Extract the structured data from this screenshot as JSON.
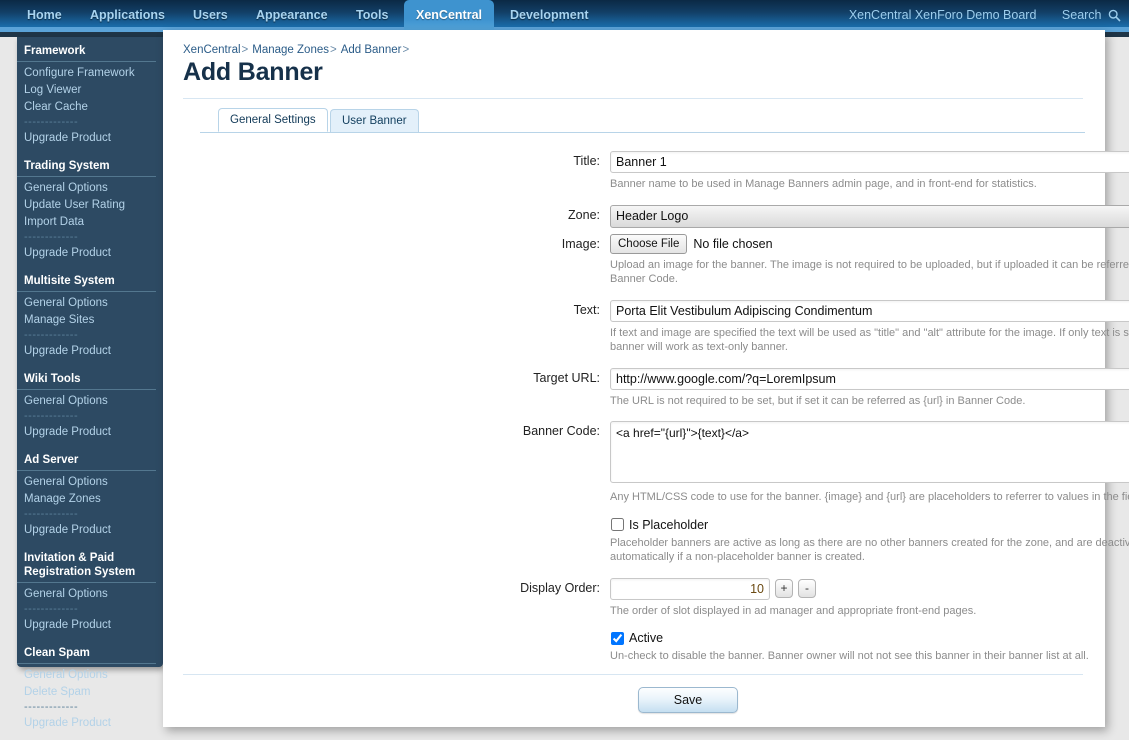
{
  "topnav": {
    "tabs": [
      {
        "label": "Home",
        "active": false
      },
      {
        "label": "Applications",
        "active": false
      },
      {
        "label": "Users",
        "active": false
      },
      {
        "label": "Appearance",
        "active": false
      },
      {
        "label": "Tools",
        "active": false
      },
      {
        "label": "XenCentral",
        "active": true
      },
      {
        "label": "Development",
        "active": false
      }
    ],
    "board_name": "XenCentral XenForo Demo Board",
    "search_label": "Search",
    "accent_active": "#3e93cf",
    "accent_strip": "#5ba3d8"
  },
  "sidebar": {
    "groups": [
      {
        "title": "Framework",
        "items": [
          "Configure Framework",
          "Log Viewer",
          "Clear Cache",
          "-------------",
          "Upgrade Product"
        ]
      },
      {
        "title": "Trading System",
        "items": [
          "General Options",
          "Update User Rating",
          "Import Data",
          "-------------",
          "Upgrade Product"
        ]
      },
      {
        "title": "Multisite System",
        "items": [
          "General Options",
          "Manage Sites",
          "-------------",
          "Upgrade Product"
        ]
      },
      {
        "title": "Wiki Tools",
        "items": [
          "General Options",
          "-------------",
          "Upgrade Product"
        ]
      },
      {
        "title": "Ad Server",
        "items": [
          "General Options",
          "Manage Zones",
          "-------------",
          "Upgrade Product"
        ]
      },
      {
        "title": "Invitation & Paid Registration System",
        "items": [
          "General Options",
          "-------------",
          "Upgrade Product"
        ]
      },
      {
        "title": "Clean Spam",
        "items": [
          "General Options",
          "Delete Spam",
          "-------------",
          "Upgrade Product"
        ]
      }
    ]
  },
  "breadcrumb": {
    "crumbs": [
      "XenCentral",
      "Manage Zones",
      "Add Banner"
    ],
    "separator": ">"
  },
  "page": {
    "title": "Add Banner"
  },
  "tabs": [
    {
      "label": "General Settings",
      "active": true
    },
    {
      "label": "User Banner",
      "active": false
    }
  ],
  "form": {
    "title": {
      "label": "Title:",
      "value": "Banner 1",
      "placeholder": "",
      "hint": "Banner name to be used in Manage Banners admin page, and in front-end for statistics."
    },
    "zone": {
      "label": "Zone:",
      "selected": "Header Logo",
      "options": [
        "Header Logo"
      ]
    },
    "image": {
      "label": "Image:",
      "button_label": "Choose File",
      "file_status": "No file chosen",
      "hint": "Upload an image for the banner. The image is not required to be uploaded, but if uploaded it can be referred as {image} in Banner Code."
    },
    "text": {
      "label": "Text:",
      "value": "Porta Elit Vestibulum Adipiscing Condimentum",
      "placeholder": "",
      "hint": "If text and image are specified the text will be used as \"title\" and \"alt\" attribute for the image. If only text is specified the banner will work as text-only banner."
    },
    "target_url": {
      "label": "Target URL:",
      "value": "http://www.google.com/?q=LoremIpsum",
      "placeholder": "",
      "hint": "The URL is not required to be set, but if set it can be referred as {url} in Banner Code."
    },
    "banner_code": {
      "label": "Banner Code:",
      "value": "<a href=\"{url}\">{text}</a>",
      "placeholder": "",
      "hint": "Any HTML/CSS code to use for the banner. {image} and {url} are placeholders to referrer to values in the fields above."
    },
    "is_placeholder": {
      "label": "Is Placeholder",
      "checked": false,
      "hint": "Placeholder banners are active as long as there are no other banners created for the zone, and are deactivated automatically if a non-placeholder banner is created."
    },
    "display_order": {
      "label": "Display Order:",
      "value": "10",
      "increment_label": "+",
      "decrement_label": "-",
      "hint": "The order of slot displayed in ad manager and appropriate front-end pages."
    },
    "active": {
      "label": "Active",
      "checked": true,
      "hint": "Un-check to disable the banner. Banner owner will not not see this banner in their banner list at all."
    },
    "save_label": "Save"
  }
}
